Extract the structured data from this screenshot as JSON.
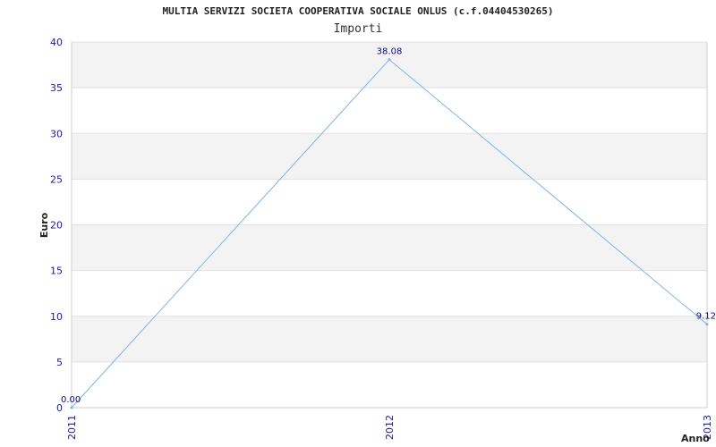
{
  "chart_data": {
    "type": "line",
    "title": "MULTIA SERVIZI SOCIETA COOPERATIVA SOCIALE ONLUS (c.f.04404530265)",
    "subtitle": "Importi",
    "xlabel": "Anno",
    "ylabel": "Euro",
    "categories": [
      "2011",
      "2012",
      "2013"
    ],
    "series": [
      {
        "values": [
          0.0,
          38.08,
          9.12
        ],
        "labels": [
          "0.00",
          "38.08",
          "9.12"
        ]
      }
    ],
    "ylim": [
      0,
      40
    ],
    "yticks": [
      0,
      5,
      10,
      15,
      20,
      25,
      30,
      35,
      40
    ],
    "grid": true,
    "colors": {
      "line": "#7fb3e6",
      "band": "#f3f3f3",
      "tick_text": "#1a1aa6",
      "label_text": "#0a0a7a"
    }
  }
}
